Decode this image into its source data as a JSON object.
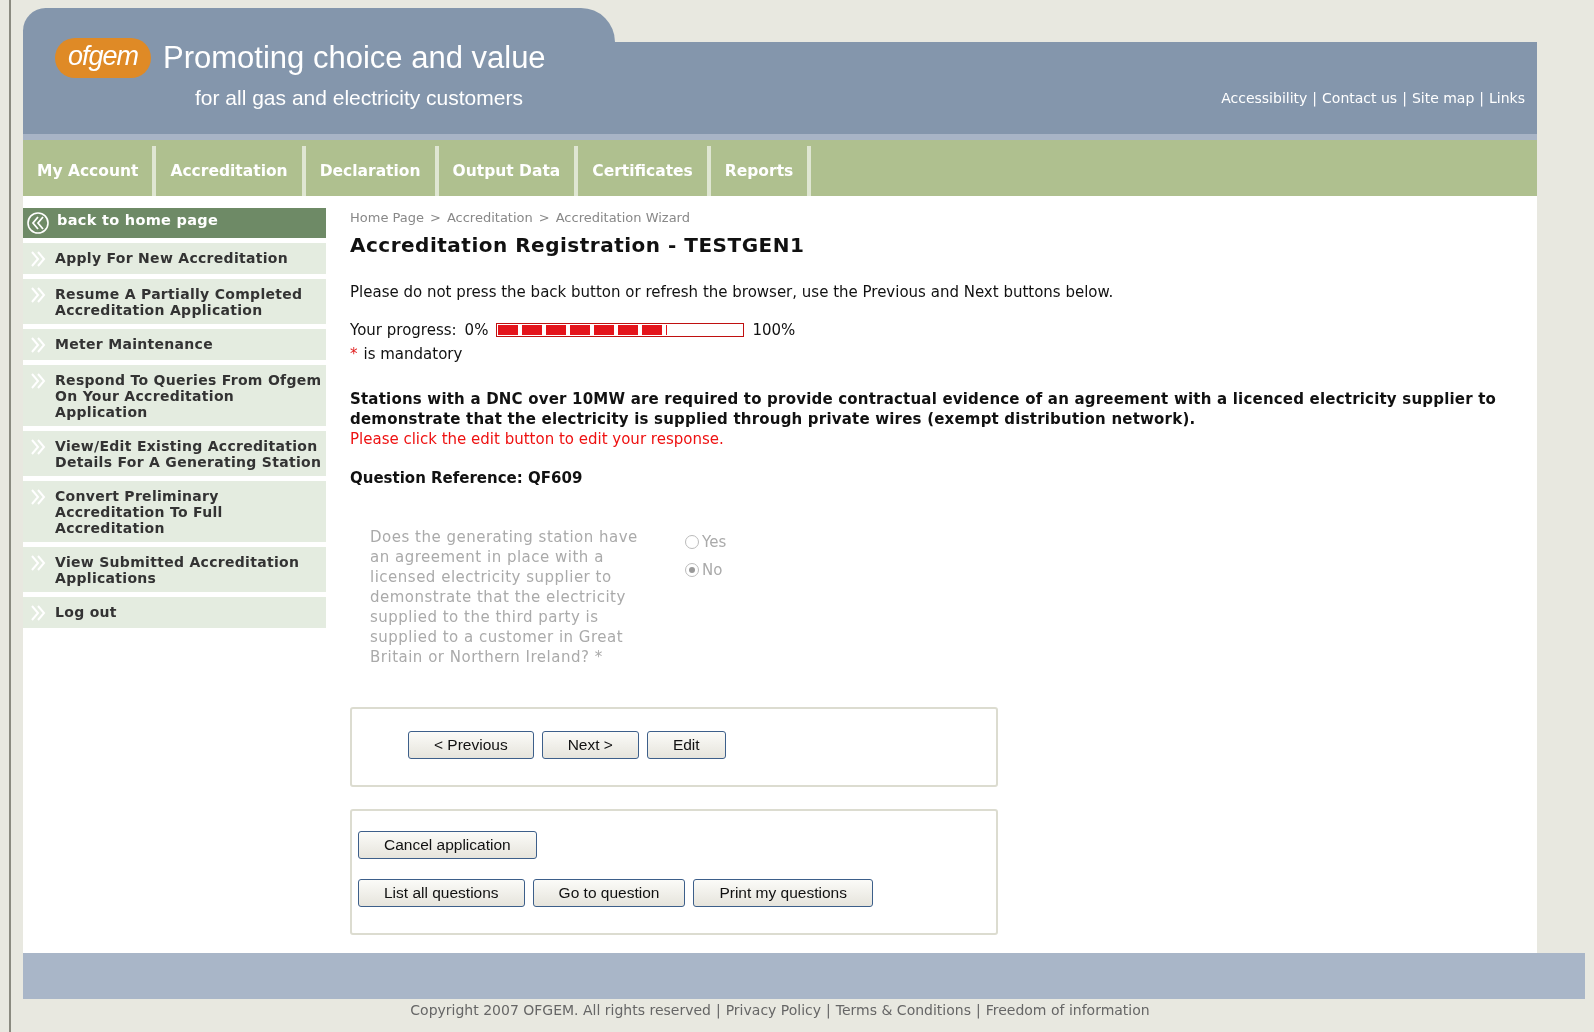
{
  "header": {
    "logo": "ofgem",
    "title": "Promoting choice and value",
    "subtitle": "for all gas and electricity customers",
    "links": [
      "Accessibility",
      "Contact us",
      "Site map",
      "Links"
    ],
    "separator": "|"
  },
  "nav": [
    "My Account",
    "Accreditation",
    "Declaration",
    "Output Data",
    "Certificates",
    "Reports"
  ],
  "sidebar": {
    "items": [
      {
        "label": "back to home page",
        "kind": "back"
      },
      {
        "label": "Apply For New Accreditation",
        "kind": "link"
      },
      {
        "label": "Resume A Partially Completed Accreditation Application",
        "kind": "link"
      },
      {
        "label": "Meter Maintenance",
        "kind": "link"
      },
      {
        "label": "Respond To Queries From Ofgem On Your Accreditation Application",
        "kind": "link"
      },
      {
        "label": "View/Edit Existing Accreditation Details For A Generating Station",
        "kind": "link"
      },
      {
        "label": "Convert Preliminary Accreditation To Full Accreditation",
        "kind": "link"
      },
      {
        "label": "View Submitted Accreditation Applications",
        "kind": "link"
      },
      {
        "label": "Log out",
        "kind": "link"
      }
    ]
  },
  "breadcrumb": [
    "Home Page",
    "Accreditation",
    "Accreditation Wizard"
  ],
  "breadcrumb_separator": ">",
  "title": "Accreditation Registration - TESTGEN1",
  "instruction": "Please do not press the back button or refresh the browser, use the Previous and Next buttons below.",
  "progress": {
    "label": "Your progress:",
    "start": "0%",
    "end": "100%",
    "level": 0.69
  },
  "mandatory_note": {
    "mark": "*",
    "text": "is mandatory"
  },
  "notice": "Stations with a DNC over 10MW are required to provide contractual evidence of an agreement with a licenced electricity supplier to demonstrate that the electricity is supplied through private wires (exempt distribution network).",
  "edit_hint": "Please click the edit button to edit your response.",
  "question_reference": "Question Reference: QF609",
  "question": {
    "text": "Does the generating station have an agreement in place with a licensed electricity supplier to demonstrate that the electricity supplied to the third party is supplied to a customer in Great Britain or Northern Ireland? *",
    "disabled": true,
    "options": [
      {
        "label": "Yes",
        "selected": false
      },
      {
        "label": "No",
        "selected": true
      }
    ]
  },
  "wizard_buttons": [
    "< Previous",
    "Next >",
    "Edit"
  ],
  "application_buttons": {
    "first_row": [
      "Cancel application"
    ],
    "second_row": [
      "List all questions",
      "Go to question",
      "Print my questions"
    ]
  },
  "footer": {
    "copyright": "Copyright 2007 OFGEM. All rights reserved",
    "links": [
      "Privacy Policy",
      "Terms & Conditions",
      "Freedom of information"
    ],
    "separator": "|"
  }
}
